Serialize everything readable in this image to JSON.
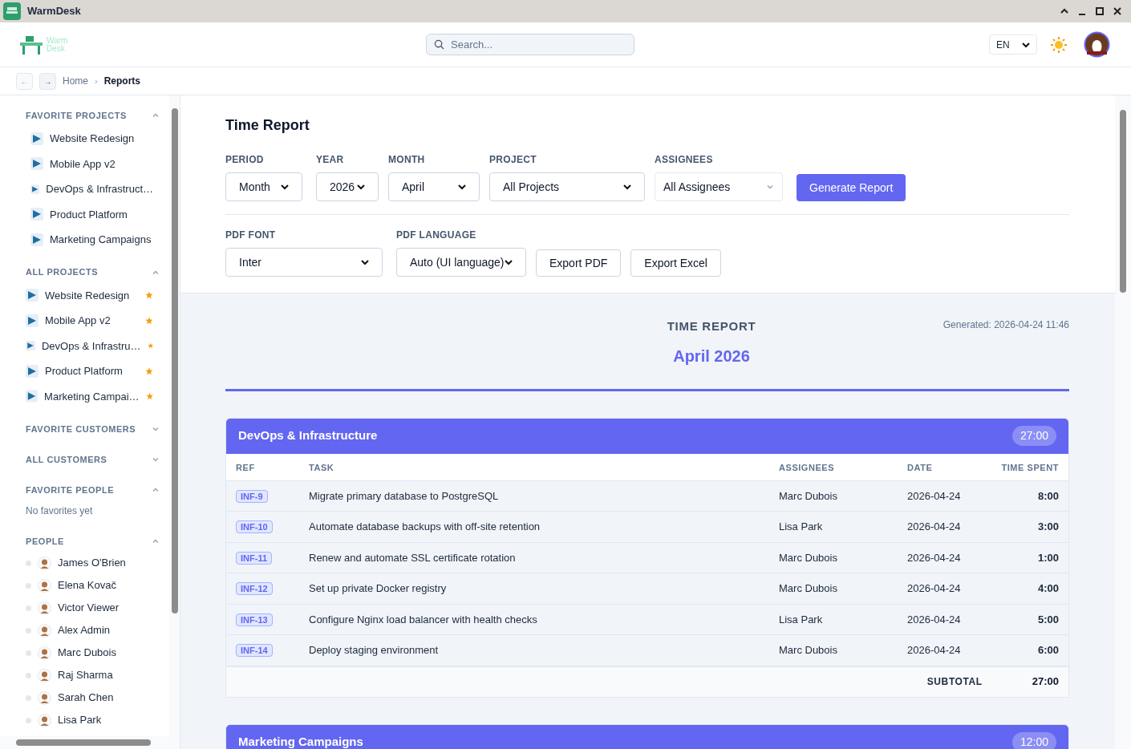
{
  "window": {
    "title": "WarmDesk"
  },
  "header": {
    "logo": [
      "Warm",
      "Desk"
    ],
    "search": {
      "placeholder": "Search..."
    },
    "language": "EN"
  },
  "breadcrumb": {
    "back": "←",
    "forward": "→",
    "items": [
      {
        "label": "Home",
        "selected": false
      },
      {
        "label": "Reports",
        "selected": true
      }
    ],
    "separator": "›"
  },
  "sidebar": {
    "sections": [
      {
        "title": "FAVORITE PROJECTS",
        "expanded": true,
        "kind": "projects",
        "items": [
          {
            "label": "Website Redesign",
            "favorite": false
          },
          {
            "label": "Mobile App v2",
            "favorite": false
          },
          {
            "label": "DevOps & Infrastruct…",
            "favorite": false
          },
          {
            "label": "Product Platform",
            "favorite": false
          },
          {
            "label": "Marketing Campaigns",
            "favorite": false
          }
        ]
      },
      {
        "title": "ALL PROJECTS",
        "expanded": true,
        "kind": "projects",
        "items": [
          {
            "label": "Website Redesign",
            "favorite": true
          },
          {
            "label": "Mobile App v2",
            "favorite": true
          },
          {
            "label": "DevOps & Infrastru…",
            "favorite": true
          },
          {
            "label": "Product Platform",
            "favorite": true
          },
          {
            "label": "Marketing Campai…",
            "favorite": true
          }
        ]
      },
      {
        "title": "FAVORITE CUSTOMERS",
        "expanded": false
      },
      {
        "title": "ALL CUSTOMERS",
        "expanded": false
      },
      {
        "title": "FAVORITE PEOPLE",
        "expanded": true,
        "note": "No favorites yet"
      },
      {
        "title": "PEOPLE",
        "expanded": true,
        "kind": "people",
        "items": [
          {
            "label": "James O'Brien",
            "online": false
          },
          {
            "label": "Elena Kovač",
            "online": false
          },
          {
            "label": "Victor Viewer",
            "online": false
          },
          {
            "label": "Alex Admin",
            "online": false
          },
          {
            "label": "Marc Dubois",
            "online": false
          },
          {
            "label": "Raj Sharma",
            "online": false
          },
          {
            "label": "Sarah Chen",
            "online": false
          },
          {
            "label": "Lisa Park",
            "online": false
          }
        ]
      }
    ]
  },
  "form": {
    "title": "Time Report",
    "filters": [
      {
        "label": "PERIOD",
        "kind": "select",
        "value": "Month"
      },
      {
        "label": "YEAR",
        "kind": "select",
        "value": "2026"
      },
      {
        "label": "MONTH",
        "kind": "select",
        "value": "April"
      },
      {
        "label": "PROJECT",
        "kind": "select",
        "value": "All Projects"
      },
      {
        "label": "ASSIGNEES",
        "kind": "dropdown",
        "value": "All Assignees"
      },
      {
        "kind": "primary",
        "value": "Generate Report"
      }
    ],
    "exports": [
      {
        "label": "PDF FONT",
        "kind": "select",
        "value": "Inter"
      },
      {
        "label": "PDF LANGUAGE",
        "kind": "select",
        "value": "Auto (UI language)"
      },
      {
        "kind": "secondary",
        "value": "Export PDF"
      },
      {
        "kind": "secondary",
        "value": "Export Excel"
      }
    ]
  },
  "report": {
    "heading": "TIME REPORT",
    "period": "April 2026",
    "generated": "Generated: 2026-04-24 11:46",
    "columns": [
      "REF",
      "TASK",
      "ASSIGNEES",
      "DATE",
      "TIME SPENT"
    ],
    "groups": [
      {
        "name": "DevOps & Infrastructure",
        "total": "27:00",
        "subtotal_label": "SUBTOTAL",
        "subtotal": "27:00",
        "rows": [
          {
            "ref": "INF-9",
            "task": "Migrate primary database to PostgreSQL",
            "assignee": "Marc Dubois",
            "date": "2026-04-24",
            "time": "8:00"
          },
          {
            "ref": "INF-10",
            "task": "Automate database backups with off-site retention",
            "assignee": "Lisa Park",
            "date": "2026-04-24",
            "time": "3:00"
          },
          {
            "ref": "INF-11",
            "task": "Renew and automate SSL certificate rotation",
            "assignee": "Marc Dubois",
            "date": "2026-04-24",
            "time": "1:00"
          },
          {
            "ref": "INF-12",
            "task": "Set up private Docker registry",
            "assignee": "Marc Dubois",
            "date": "2026-04-24",
            "time": "4:00"
          },
          {
            "ref": "INF-13",
            "task": "Configure Nginx load balancer with health checks",
            "assignee": "Lisa Park",
            "date": "2026-04-24",
            "time": "5:00"
          },
          {
            "ref": "INF-14",
            "task": "Deploy staging environment",
            "assignee": "Marc Dubois",
            "date": "2026-04-24",
            "time": "6:00"
          }
        ]
      },
      {
        "name": "Marketing Campaigns",
        "total": "12:00"
      }
    ]
  }
}
